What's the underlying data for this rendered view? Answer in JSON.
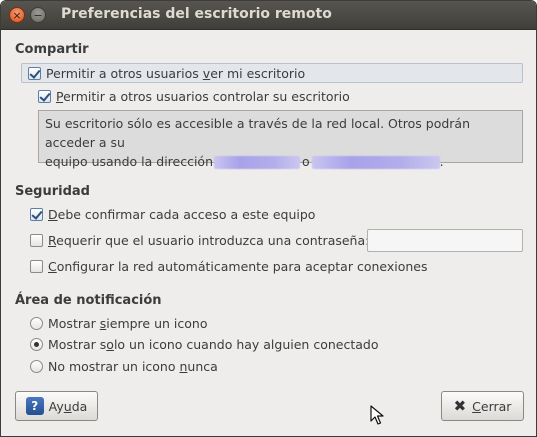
{
  "window": {
    "title": "Preferencias del escritorio remoto",
    "close_glyph": "×",
    "minimize_glyph": "−"
  },
  "share": {
    "heading": "Compartir",
    "allow_view": {
      "pre": "Permitir a otros usuarios ",
      "accel": "v",
      "post": "er mi escritorio",
      "checked": true
    },
    "allow_control": {
      "pre": "",
      "accel": "P",
      "post": "ermitir a otros usuarios controlar su escritorio",
      "checked": true
    },
    "info_line1": "Su escritorio sólo es accesible a través de la red local. Otros podrán acceder a su",
    "info_line2_pre": "equipo usando la dirección",
    "info_line2_mid": "o",
    "info_line2_post": "."
  },
  "security": {
    "heading": "Seguridad",
    "confirm": {
      "pre": "",
      "accel": "D",
      "post": "ebe confirmar cada acceso a este equipo",
      "checked": true
    },
    "require_password": {
      "pre": "",
      "accel": "R",
      "post": "equerir que el usuario introduzca una contraseña:",
      "checked": false
    },
    "password_value": "",
    "auto_network": {
      "pre": "",
      "accel": "C",
      "post": "onfigurar la red automáticamente para aceptar conexiones",
      "checked": false
    }
  },
  "notification": {
    "heading": "Área de notificación",
    "always": {
      "pre": "Mostrar ",
      "accel": "s",
      "post": "iempre un icono",
      "selected": false
    },
    "only_connected": {
      "pre": "Mostrar s",
      "accel": "o",
      "post": "lo un icono cuando hay alguien conectado",
      "selected": true
    },
    "never": {
      "pre": "No mostrar un icono ",
      "accel": "n",
      "post": "unca",
      "selected": false
    }
  },
  "buttons": {
    "help": {
      "glyph": "?",
      "pre": "Ay",
      "accel": "u",
      "post": "da"
    },
    "close": {
      "glyph": "✖",
      "pre": "",
      "accel": "C",
      "post": "errar"
    }
  },
  "colors": {
    "titlebar": "#4a4944",
    "window_bg": "#eeedec",
    "close_button": "#dd4f17",
    "help_icon": "#2f5ea8",
    "redaction": "#b0aaeb"
  },
  "icons": {
    "window_close": "close-icon",
    "window_minimize": "minimize-icon",
    "help": "help-icon",
    "close_button": "close-x-icon",
    "pointer": "mouse-pointer-icon"
  }
}
